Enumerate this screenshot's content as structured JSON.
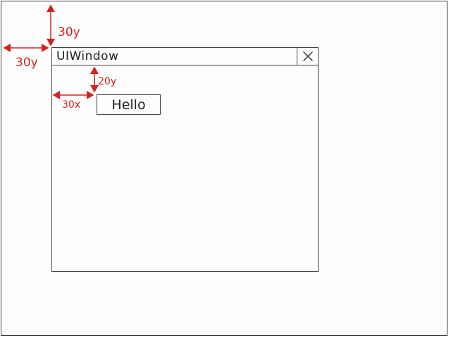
{
  "window": {
    "title": "UIWindow",
    "close_icon": "close-icon",
    "button_label": "Hello"
  },
  "annotations": {
    "top_offset": "30y",
    "left_offset": "30y",
    "button_top_offset": "20y",
    "button_left_offset": "30x",
    "color": "#d42020"
  }
}
